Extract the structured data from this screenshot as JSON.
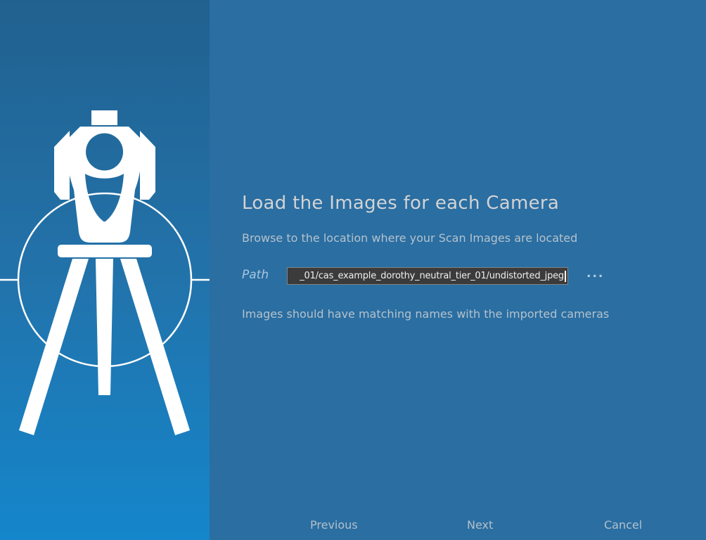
{
  "wizard": {
    "title": "Load the Images for each Camera",
    "subtitle": "Browse to the location where your Scan Images are located",
    "path": {
      "label": "Path",
      "value": "_01/cas_example_dorothy_neutral_tier_01/undistorted_jpeg",
      "browse_label": "..."
    },
    "info": "Images should have matching names with the imported cameras",
    "footer": {
      "previous": "Previous",
      "next": "Next",
      "cancel": "Cancel"
    }
  },
  "icons": {
    "side_panel_icon": "total-station-scanner-on-tripod",
    "browse_icon": "ellipsis",
    "caret_icon": "text-caret"
  },
  "colors": {
    "right_panel_bg": "#2a6ea2",
    "left_panel_gradient_top": "#21618f",
    "left_panel_gradient_bottom": "#1486cb",
    "title_text": "#d3d3d3",
    "body_text": "#b5c2cb",
    "path_label_text": "#a9c6de",
    "input_bg": "#3b3b3b",
    "input_border": "#828282",
    "input_text": "#f0f0f0",
    "footer_text": "#b3c0c9",
    "icon_fill": "#ffffff"
  }
}
